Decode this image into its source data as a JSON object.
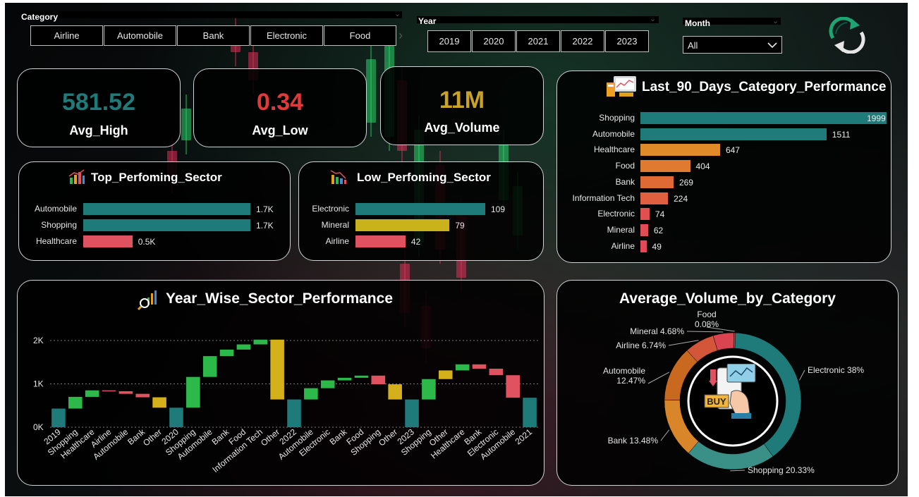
{
  "filters": {
    "category": {
      "title": "Category",
      "options": [
        "Airline",
        "Automobile",
        "Bank",
        "Electronic",
        "Food"
      ]
    },
    "year": {
      "title": "Year",
      "options": [
        "2019",
        "2020",
        "2021",
        "2022",
        "2023"
      ]
    },
    "month": {
      "title": "Month",
      "selected": "All"
    }
  },
  "kpis": {
    "avg_high": {
      "value": "581.52",
      "label": "Avg_High",
      "color": "#1f7a7a"
    },
    "avg_low": {
      "value": "0.34",
      "label": "Avg_Low",
      "color": "#e03a3a"
    },
    "avg_volume": {
      "value": "11M",
      "label": "Avg_Volume",
      "color": "#c9a227"
    }
  },
  "top_sector": {
    "title": "Top_Perfoming_Sector",
    "items": [
      {
        "label": "Automobile",
        "value": 1.7,
        "display": "1.7K",
        "color": "#1f7a7a"
      },
      {
        "label": "Shopping",
        "value": 1.7,
        "display": "1.7K",
        "color": "#1f7a7a"
      },
      {
        "label": "Healthcare",
        "value": 0.5,
        "display": "0.5K",
        "color": "#e05260"
      }
    ]
  },
  "low_sector": {
    "title": "Low_Perfoming_Sector",
    "items": [
      {
        "label": "Electronic",
        "value": 109,
        "display": "109",
        "color": "#1f7a7a"
      },
      {
        "label": "Mineral",
        "value": 79,
        "display": "79",
        "color": "#c9b21a"
      },
      {
        "label": "Airline",
        "value": 42,
        "display": "42",
        "color": "#e05260"
      }
    ]
  },
  "last90": {
    "title": "Last_90_Days_Category_Performance",
    "items": [
      {
        "label": "Shopping",
        "value": 1999,
        "display": "1999",
        "color": "#1f7a7a"
      },
      {
        "label": "Automobile",
        "value": 1511,
        "display": "1511",
        "color": "#1f7a7a"
      },
      {
        "label": "Healthcare",
        "value": 647,
        "display": "647",
        "color": "#e08a2a"
      },
      {
        "label": "Food",
        "value": 404,
        "display": "404",
        "color": "#e07a30"
      },
      {
        "label": "Bank",
        "value": 269,
        "display": "269",
        "color": "#e06a36"
      },
      {
        "label": "Information Tech",
        "value": 224,
        "display": "224",
        "color": "#e05f40"
      },
      {
        "label": "Electronic",
        "value": 74,
        "display": "74",
        "color": "#e05050"
      },
      {
        "label": "Mineral",
        "value": 62,
        "display": "62",
        "color": "#e04d55"
      },
      {
        "label": "Airline",
        "value": 49,
        "display": "49",
        "color": "#e04a5a"
      }
    ]
  },
  "year_wise": {
    "title": "Year_Wise_Sector_Performance"
  },
  "avg_volume": {
    "title": "Average_Volume_by_Category",
    "center_text": "BUY"
  },
  "chart_data": [
    {
      "type": "bar",
      "chart": "waterfall",
      "title": "Year_Wise_Sector_Performance",
      "ylim": [
        0,
        2000
      ],
      "yticks": [
        "0K",
        "1K",
        "2K"
      ],
      "grid": true,
      "steps": [
        {
          "label": "2019",
          "kind": "total",
          "start": 0,
          "end": 430,
          "color": "#1f7a7a"
        },
        {
          "label": "Shopping",
          "kind": "up",
          "start": 430,
          "end": 700,
          "color": "#2db84a"
        },
        {
          "label": "Healthcare",
          "kind": "up",
          "start": 700,
          "end": 850,
          "color": "#2db84a"
        },
        {
          "label": "Airline",
          "kind": "down",
          "start": 850,
          "end": 830,
          "color": "#e05260"
        },
        {
          "label": "Automobile",
          "kind": "down",
          "start": 830,
          "end": 770,
          "color": "#e05260"
        },
        {
          "label": "Bank",
          "kind": "down",
          "start": 770,
          "end": 690,
          "color": "#e05260"
        },
        {
          "label": "Other",
          "kind": "other",
          "start": 690,
          "end": 450,
          "color": "#d4b01a"
        },
        {
          "label": "2020",
          "kind": "total",
          "start": 0,
          "end": 450,
          "color": "#1f7a7a"
        },
        {
          "label": "Shopping",
          "kind": "up",
          "start": 450,
          "end": 1160,
          "color": "#2db84a"
        },
        {
          "label": "Automobile",
          "kind": "up",
          "start": 1160,
          "end": 1640,
          "color": "#2db84a"
        },
        {
          "label": "Bank",
          "kind": "up",
          "start": 1640,
          "end": 1790,
          "color": "#2db84a"
        },
        {
          "label": "Food",
          "kind": "up",
          "start": 1790,
          "end": 1910,
          "color": "#2db84a"
        },
        {
          "label": "Information Tech",
          "kind": "up",
          "start": 1910,
          "end": 2020,
          "color": "#2db84a"
        },
        {
          "label": "Other",
          "kind": "other",
          "start": 2020,
          "end": 640,
          "color": "#d4b01a"
        },
        {
          "label": "2022",
          "kind": "total",
          "start": 0,
          "end": 640,
          "color": "#1f7a7a"
        },
        {
          "label": "Automobile",
          "kind": "up",
          "start": 640,
          "end": 900,
          "color": "#2db84a"
        },
        {
          "label": "Electronic",
          "kind": "up",
          "start": 900,
          "end": 1080,
          "color": "#2db84a"
        },
        {
          "label": "Bank",
          "kind": "up",
          "start": 1080,
          "end": 1140,
          "color": "#2db84a"
        },
        {
          "label": "Food",
          "kind": "up",
          "start": 1140,
          "end": 1190,
          "color": "#2db84a"
        },
        {
          "label": "Shopping",
          "kind": "down",
          "start": 1190,
          "end": 990,
          "color": "#e05260"
        },
        {
          "label": "Other",
          "kind": "other",
          "start": 990,
          "end": 640,
          "color": "#d4b01a"
        },
        {
          "label": "2023",
          "kind": "total",
          "start": 0,
          "end": 640,
          "color": "#1f7a7a"
        },
        {
          "label": "Shopping",
          "kind": "up",
          "start": 640,
          "end": 1110,
          "color": "#2db84a"
        },
        {
          "label": "Other",
          "kind": "other",
          "start": 1110,
          "end": 1310,
          "color": "#d4b01a"
        },
        {
          "label": "Healthcare",
          "kind": "up",
          "start": 1310,
          "end": 1450,
          "color": "#2db84a"
        },
        {
          "label": "Bank",
          "kind": "down",
          "start": 1450,
          "end": 1350,
          "color": "#e05260"
        },
        {
          "label": "Electronic",
          "kind": "down",
          "start": 1350,
          "end": 1200,
          "color": "#e05260"
        },
        {
          "label": "Automobile",
          "kind": "down",
          "start": 1200,
          "end": 680,
          "color": "#e05260"
        },
        {
          "label": "2021",
          "kind": "total",
          "start": 0,
          "end": 680,
          "color": "#1f7a7a"
        }
      ]
    },
    {
      "type": "pie",
      "chart": "donut",
      "title": "Average_Volume_by_Category",
      "slices": [
        {
          "label": "Electronic",
          "value": 38,
          "display": "Electronic 38%",
          "color": "#1f7a7a"
        },
        {
          "label": "Shopping",
          "value": 20.33,
          "display": "Shopping 20.33%",
          "color": "#3a8f86"
        },
        {
          "label": "Bank",
          "value": 13.48,
          "display": "Bank 13.48%",
          "color": "#d9862a"
        },
        {
          "label": "Automobile",
          "value": 12.47,
          "display": "Automobile 12.47%",
          "color": "#c8691f"
        },
        {
          "label": "Airline",
          "value": 6.74,
          "display": "Airline 6.74%",
          "color": "#d4563a"
        },
        {
          "label": "Mineral",
          "value": 4.68,
          "display": "Mineral 4.68%",
          "color": "#d94450"
        },
        {
          "label": "Food",
          "value": 0.08,
          "display": "Food 0.08%",
          "color": "#e0303a"
        }
      ]
    }
  ]
}
